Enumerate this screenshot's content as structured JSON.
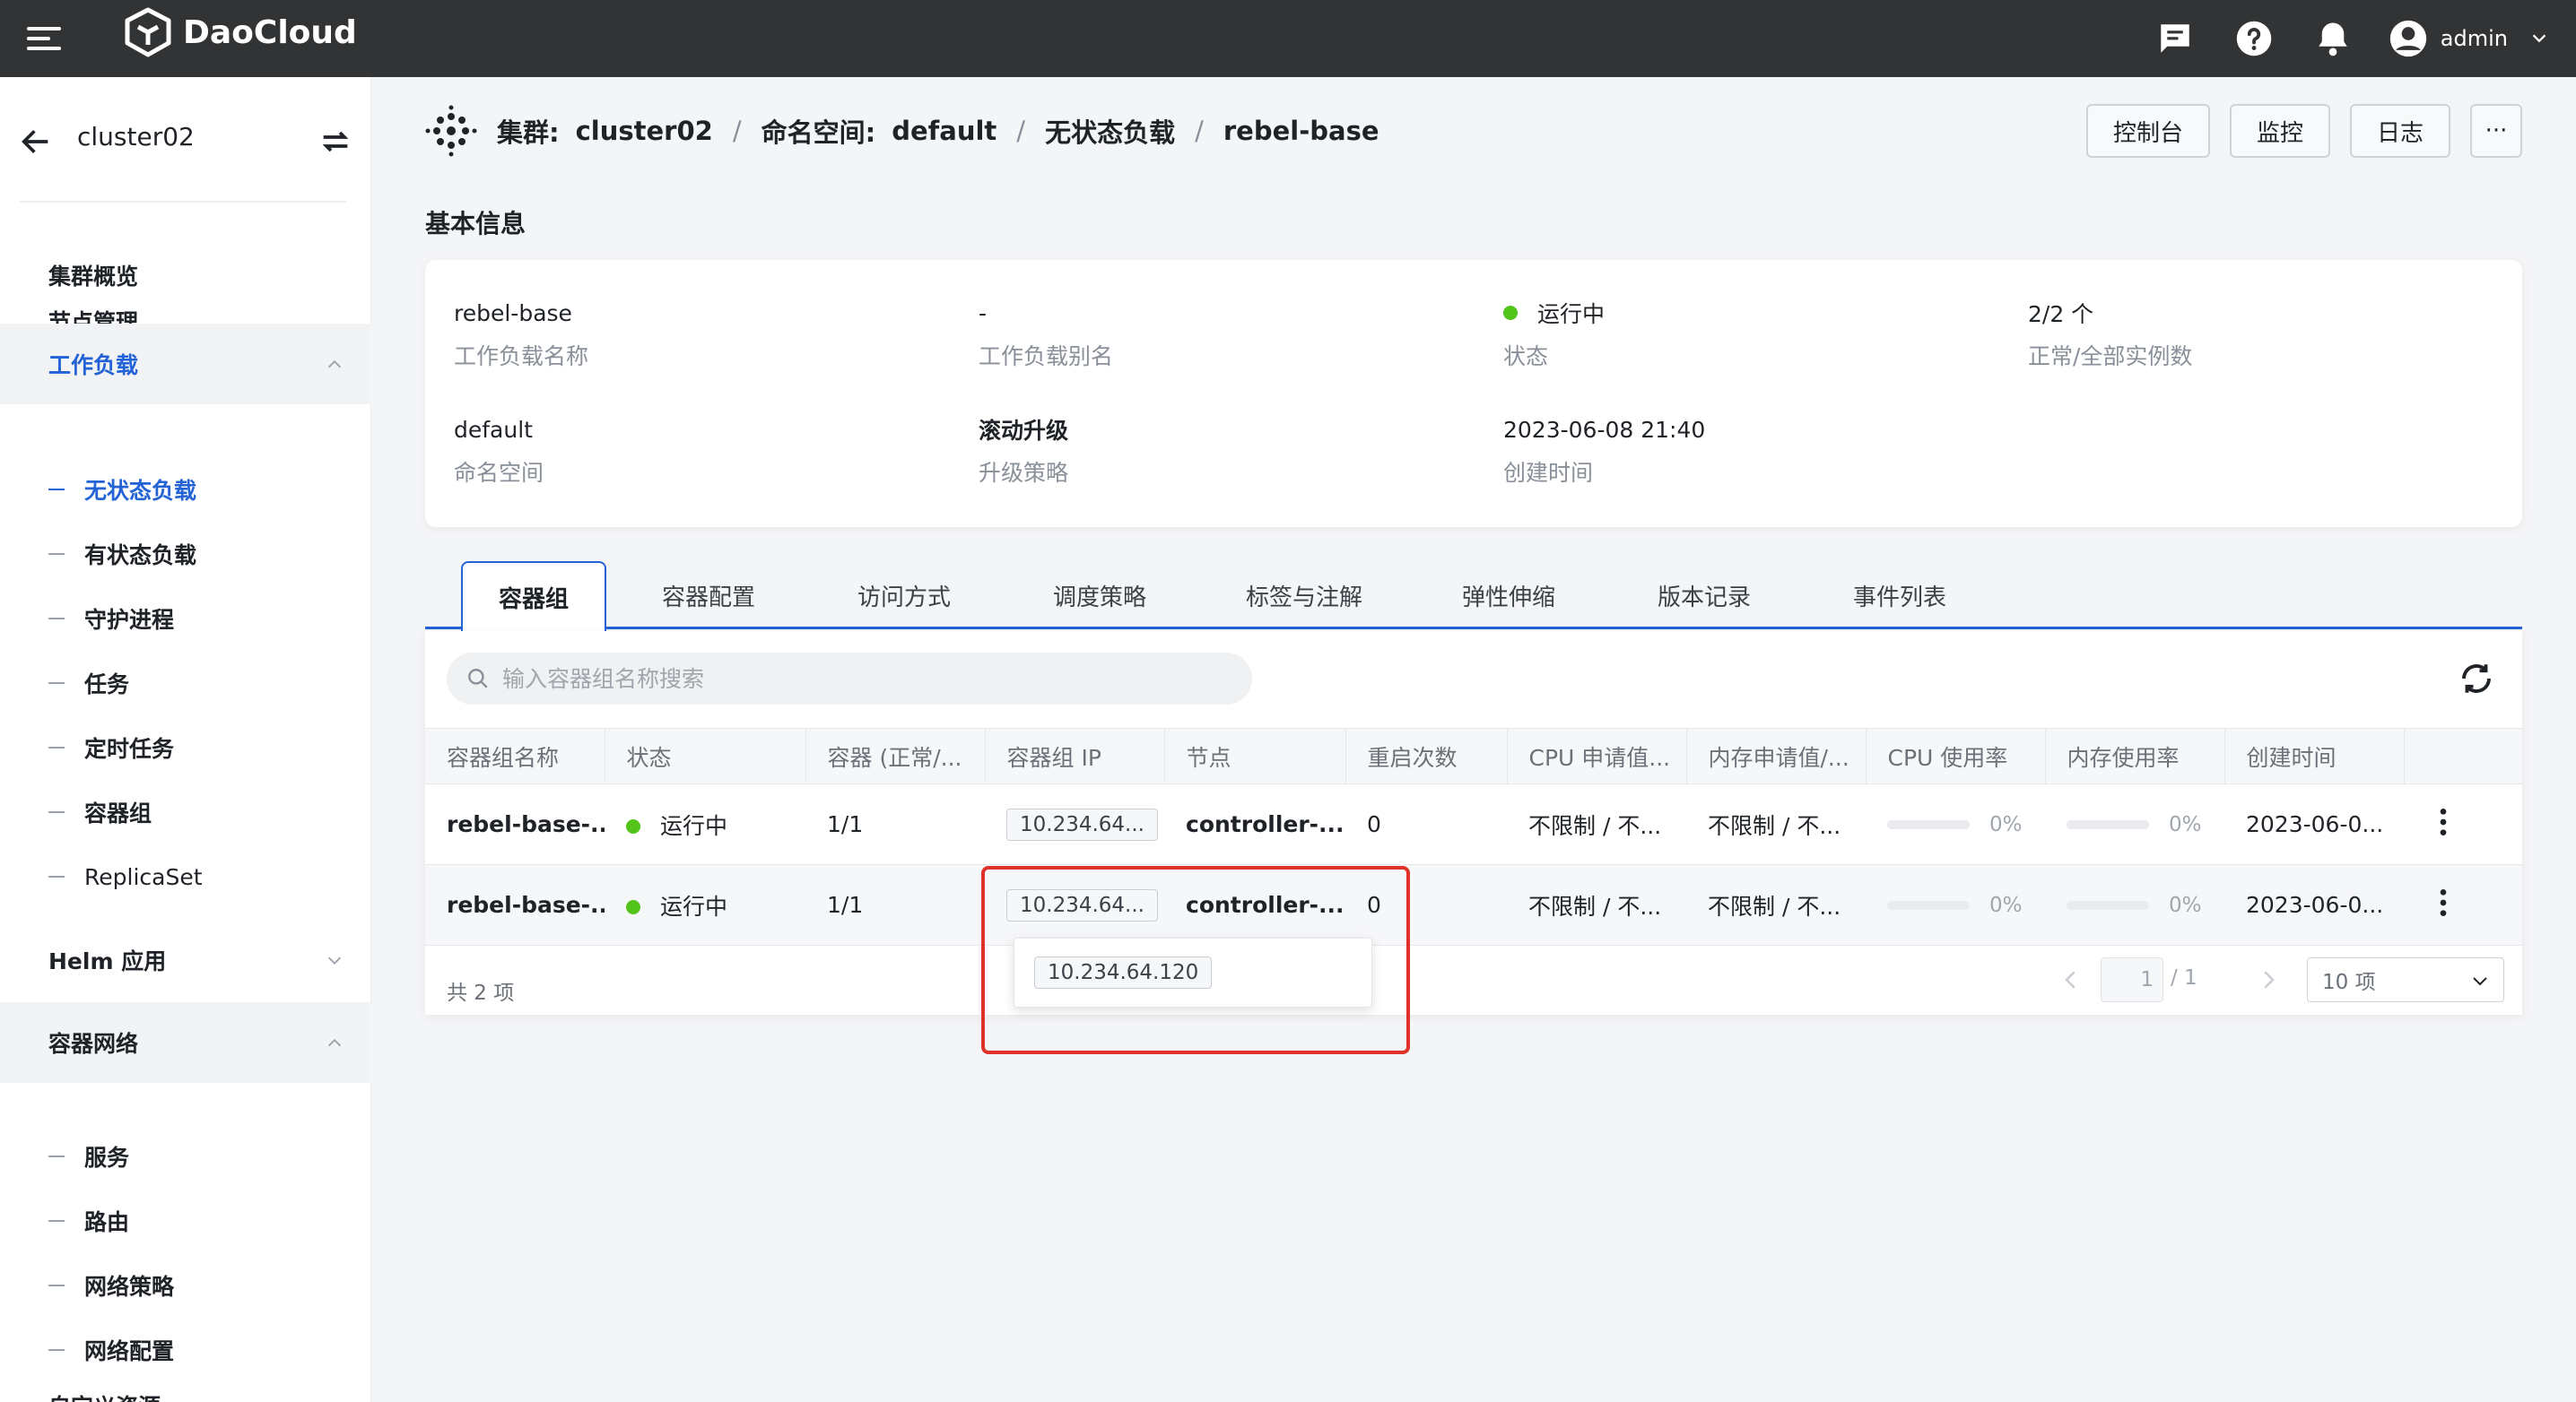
{
  "topbar": {
    "brand": "DaoCloud",
    "user_name": "admin",
    "icons": [
      "menu-icon",
      "message-icon",
      "help-icon",
      "bell-icon",
      "user-avatar-icon",
      "chevron-down-icon"
    ]
  },
  "sidebar": {
    "cluster": "cluster02",
    "items": [
      {
        "label": "集群概览"
      },
      {
        "label": "节点管理"
      },
      {
        "label": "工作负载"
      },
      {
        "label": "Helm 应用"
      },
      {
        "label": "容器网络"
      },
      {
        "label": "自定义资源"
      }
    ],
    "workload_sub": [
      "无状态负载",
      "有状态负载",
      "守护进程",
      "任务",
      "定时任务",
      "容器组",
      "ReplicaSet"
    ],
    "network_sub": [
      "服务",
      "路由",
      "网络策略",
      "网络配置"
    ]
  },
  "breadcrumb": {
    "cluster_label": "集群:",
    "cluster_value": "cluster02",
    "namespace_label": "命名空间:",
    "namespace_value": "default",
    "section": "无状态负载",
    "current": "rebel-base",
    "separator": "/"
  },
  "header_buttons": {
    "console": "控制台",
    "monitor": "监控",
    "logs": "日志",
    "more": "···"
  },
  "basic_info": {
    "title": "基本信息",
    "fields": [
      {
        "value": "rebel-base",
        "label": "工作负载名称"
      },
      {
        "value": "-",
        "label": "工作负载别名"
      },
      {
        "value": "运行中",
        "label": "状态"
      },
      {
        "value": "2/2 个",
        "label": "正常/全部实例数"
      },
      {
        "value": "default",
        "label": "命名空间"
      },
      {
        "value": "滚动升级",
        "label": "升级策略"
      },
      {
        "value": "2023-06-08 21:40",
        "label": "创建时间"
      }
    ]
  },
  "tabs": [
    "容器组",
    "容器配置",
    "访问方式",
    "调度策略",
    "标签与注解",
    "弹性伸缩",
    "版本记录",
    "事件列表"
  ],
  "search": {
    "placeholder": "输入容器组名称搜索"
  },
  "table": {
    "columns": [
      "容器组名称",
      "状态",
      "容器 (正常/...",
      "容器组 IP",
      "节点",
      "重启次数",
      "CPU 申请值...",
      "内存申请值/...",
      "CPU 使用率",
      "内存使用率",
      "创建时间"
    ],
    "rows": [
      {
        "name": "rebel-base-...",
        "status": "运行中",
        "containers": "1/1",
        "ip": "10.234.64...",
        "node": "controller-...",
        "restarts": "0",
        "cpu_req": "不限制 / 不...",
        "mem_req": "不限制 / 不...",
        "cpu_use": "0%",
        "mem_use": "0%",
        "cpu_use_value": 0,
        "mem_use_value": 0,
        "created": "2023-06-0..."
      },
      {
        "name": "rebel-base-...",
        "status": "运行中",
        "containers": "1/1",
        "ip": "10.234.64...",
        "node": "controller-...",
        "restarts": "0",
        "cpu_req": "不限制 / 不...",
        "mem_req": "不限制 / 不...",
        "cpu_use": "0%",
        "mem_use": "0%",
        "cpu_use_value": 0,
        "mem_use_value": 0,
        "created": "2023-06-0..."
      }
    ],
    "total": "共 2 项"
  },
  "pagination": {
    "current": "1",
    "of_total": "/ 1",
    "page_size": "10 项"
  },
  "popover": {
    "ip_full": "10.234.64.120"
  },
  "colors": {
    "accent": "#2463d6",
    "running": "#52c41a",
    "topbar": "#323334",
    "highlight": "#e0312b"
  }
}
